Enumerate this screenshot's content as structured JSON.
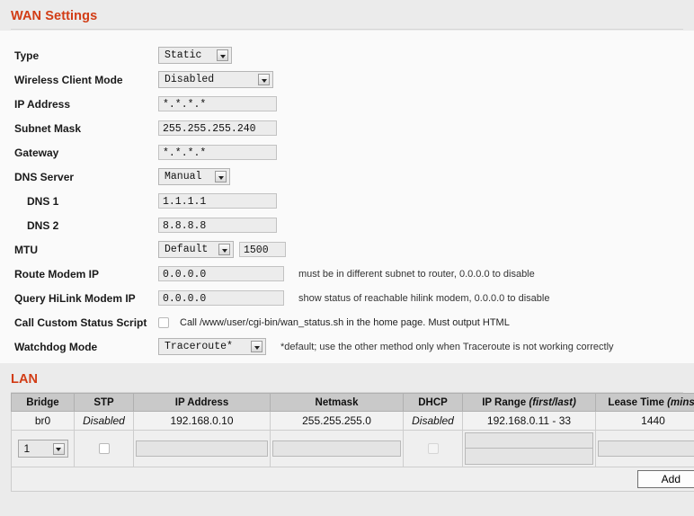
{
  "wan": {
    "title": "WAN Settings",
    "rows": [
      {
        "label": "Type",
        "type": "select",
        "value": "Static"
      },
      {
        "label": "Wireless Client Mode",
        "type": "select",
        "value": "Disabled"
      },
      {
        "label": "IP Address",
        "type": "text",
        "value": "*.*.*.*"
      },
      {
        "label": "Subnet Mask",
        "type": "text",
        "value": "255.255.255.240"
      },
      {
        "label": "Gateway",
        "type": "text",
        "value": "*.*.*.*"
      },
      {
        "label": "DNS Server",
        "type": "select",
        "value": "Manual"
      },
      {
        "label": "DNS 1",
        "type": "text",
        "value": "1.1.1.1"
      },
      {
        "label": "DNS 2",
        "type": "text",
        "value": "8.8.8.8"
      },
      {
        "label": "MTU",
        "type": "select+text",
        "value": "Default",
        "value2": "1500"
      },
      {
        "label": "Route Modem IP",
        "type": "text",
        "value": "0.0.0.0",
        "hint": "must be in different subnet to router, 0.0.0.0 to disable"
      },
      {
        "label": "Query HiLink Modem IP",
        "type": "text",
        "value": "0.0.0.0",
        "hint": "show status of reachable hilink modem, 0.0.0.0 to disable"
      },
      {
        "label": "Call Custom Status Script",
        "type": "checkbox",
        "checkbox_label": "Call /www/user/cgi-bin/wan_status.sh in the home page. Must output HTML",
        "checked": false
      },
      {
        "label": "Watchdog Mode",
        "type": "select",
        "value": "Traceroute*",
        "hint": "*default; use the other method only when Traceroute is not working correctly"
      }
    ]
  },
  "lan": {
    "title": "LAN",
    "columns": [
      {
        "label": "Bridge",
        "em": ""
      },
      {
        "label": "STP",
        "em": ""
      },
      {
        "label": "IP Address",
        "em": ""
      },
      {
        "label": "Netmask",
        "em": ""
      },
      {
        "label": "DHCP",
        "em": ""
      },
      {
        "label": "IP Range ",
        "em": "(first/last)"
      },
      {
        "label": "Lease Time ",
        "em": "(mins)"
      }
    ],
    "rows": [
      {
        "bridge": "br0",
        "stp": "Disabled",
        "ip_address": "192.168.0.10",
        "netmask": "255.255.255.0",
        "dhcp": "Disabled",
        "ip_range": "192.168.0.11 - 33",
        "lease_time": "1440"
      }
    ],
    "edit_row": {
      "bridge_value": "1",
      "stp_checked": false,
      "ip_address": "",
      "netmask": "",
      "dhcp_checked": false,
      "ip_range_first": "",
      "ip_range_last": "",
      "lease_time": ""
    },
    "add_label": "Add"
  },
  "colors": {
    "accent": "#d23c15",
    "page_bg": "#ebebeb",
    "panel_bg": "#fafafa",
    "table_header_bg": "#c9c9c9"
  }
}
